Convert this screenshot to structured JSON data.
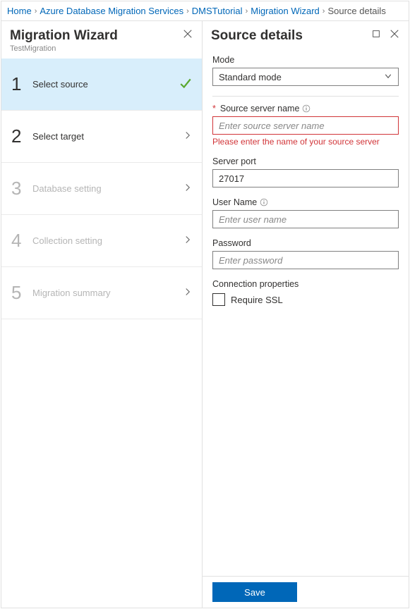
{
  "breadcrumb": {
    "items": [
      {
        "label": "Home",
        "link": true
      },
      {
        "label": "Azure Database Migration Services",
        "link": true
      },
      {
        "label": "DMSTutorial",
        "link": true
      },
      {
        "label": "Migration Wizard",
        "link": true
      },
      {
        "label": "Source details",
        "link": false
      }
    ]
  },
  "wizard": {
    "title": "Migration Wizard",
    "subtitle": "TestMigration",
    "steps": [
      {
        "num": "1",
        "label": "Select source",
        "state": "active"
      },
      {
        "num": "2",
        "label": "Select target",
        "state": "enabled"
      },
      {
        "num": "3",
        "label": "Database setting",
        "state": "disabled"
      },
      {
        "num": "4",
        "label": "Collection setting",
        "state": "disabled"
      },
      {
        "num": "5",
        "label": "Migration summary",
        "state": "disabled"
      }
    ]
  },
  "details": {
    "title": "Source details",
    "mode": {
      "label": "Mode",
      "value": "Standard mode"
    },
    "source_server": {
      "label": "Source server name",
      "placeholder": "Enter source server name",
      "error": "Please enter the name of your source server"
    },
    "server_port": {
      "label": "Server port",
      "value": "27017"
    },
    "user_name": {
      "label": "User Name",
      "placeholder": "Enter user name"
    },
    "password": {
      "label": "Password",
      "placeholder": "Enter password"
    },
    "connection_props": {
      "label": "Connection properties",
      "require_ssl": "Require SSL"
    },
    "save_label": "Save"
  }
}
